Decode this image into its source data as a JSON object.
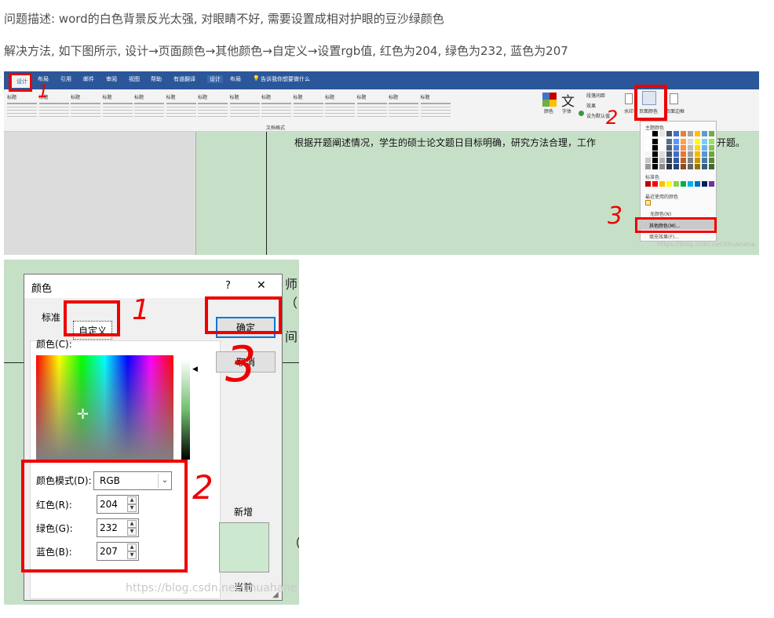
{
  "paragraphs": {
    "problem": "问题描述: word的白色背景反光太强, 对眼睛不好, 需要设置成相对护眼的豆沙绿颜色",
    "solution": "解决方法, 如下图所示, 设计→页面颜色→其他颜色→自定义→设置rgb值, 红色为204, 绿色为232, 蓝色为207"
  },
  "word_ribbon": {
    "tabs": [
      "设计",
      "布局",
      "引用",
      "邮件",
      "审阅",
      "视图",
      "帮助",
      "有道翻译",
      "设计",
      "布局"
    ],
    "tell_me": "告诉我你想要做什么",
    "style_titles": [
      "标题",
      "标题",
      "标题",
      "标题",
      "标题",
      "标题",
      "标题",
      "标题",
      "标题",
      "标题",
      "标题",
      "标题",
      "标题",
      "标题"
    ],
    "group_label": "文档格式",
    "colors_label": "颜色",
    "fonts_label": "字体",
    "paragraph_spacing": "段落间距",
    "effects": "效果",
    "set_default": "设为默认值",
    "watermark": "水印",
    "page_color": "页面颜色",
    "page_border": "页面边框"
  },
  "document": {
    "body_text": "根据开题阐述情况，学生的硕士论文题日目标明确，研究方法合理，工作",
    "body_tail": "开题。"
  },
  "color_dropdown": {
    "theme_colors": "主题颜色",
    "standard_colors": "标准色",
    "recent_colors": "最近使用的颜色",
    "no_color": "无颜色(N)",
    "more_colors": "其他颜色(M)...",
    "fill_effects": "填充效果(F)...",
    "watermark": "https://blog.csdn.net/lihuahahe"
  },
  "dialog": {
    "title": "颜色",
    "help": "?",
    "close": "✕",
    "tab_standard": "标准",
    "tab_custom": "自定义",
    "ok": "确定",
    "cancel": "取消",
    "colors_label": "颜色(C):",
    "mode_label": "颜色模式(D):",
    "mode_value": "RGB",
    "red_label": "红色(R):",
    "red_value": "204",
    "green_label": "绿色(G):",
    "green_value": "232",
    "blue_label": "蓝色(B):",
    "blue_value": "207",
    "new_label": "新增",
    "current_label": "当前",
    "watermark": "https://blog.csdn.net/lihuahahe",
    "behind_glyphs": [
      "师（",
      "间：",
      "（"
    ]
  },
  "annotations": [
    "1",
    "2",
    "3",
    "1",
    "2",
    "3"
  ],
  "colors": {
    "word_blue": "#2b579a",
    "eyecare_green": "#cce8cf",
    "annotation_red": "#ee0000",
    "focus_blue": "#0078d7"
  }
}
